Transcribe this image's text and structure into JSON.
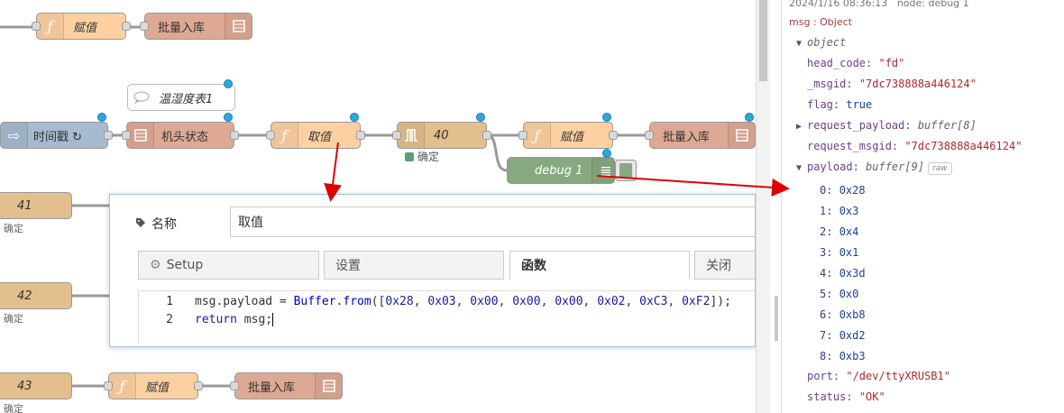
{
  "canvas": {
    "nodes": {
      "func_top": "赋值",
      "db_top": "批量入库",
      "comment": "温湿度表1",
      "inject": "时间戳 ↻",
      "serial_head": "机头状态",
      "func_take": "取值",
      "delay": "40",
      "func_assign": "赋值",
      "db_mid": "批量入库",
      "debug": "debug 1",
      "row41_label": "41",
      "row42_label": "42",
      "row43_label": "43",
      "func_bottom": "赋值",
      "db_bottom": "批量入库"
    },
    "status_ok": "确定",
    "left_status_1": "确定",
    "left_status_2": "确定",
    "left_status_3": "确定"
  },
  "dialog": {
    "name_label": "名称",
    "name_value": "取值",
    "tabs": [
      {
        "label": "Setup"
      },
      {
        "label": "设置"
      },
      {
        "label": "函数"
      },
      {
        "label": "关闭"
      }
    ],
    "code": {
      "line_numbers": [
        "1",
        "2"
      ],
      "line1": {
        "prefix": "msg.payload = ",
        "obj": "Buffer",
        "dot": ".",
        "method": "from",
        "args_open": "([",
        "nums": [
          "0x28",
          "0x03",
          "0x00",
          "0x00",
          "0x00",
          "0x02",
          "0xC3",
          "0xF2"
        ],
        "args_close": "]);"
      },
      "line2": {
        "kw": "return",
        "rest": " msg;"
      }
    }
  },
  "debug": {
    "timestamp": "2024/1/16 08:36:13",
    "node": "node: debug 1",
    "topic": "msg : Object",
    "object_label": "object",
    "fields": {
      "head_code_key": "head_code:",
      "head_code_val": "\"fd\"",
      "msgid_key": "_msgid:",
      "msgid_val": "\"7dc738888a446124\"",
      "flag_key": "flag:",
      "flag_val": "true",
      "request_payload_key": "request_payload:",
      "request_payload_type": "buffer[8]",
      "request_msgid_key": "request_msgid:",
      "request_msgid_val": "\"7dc738888a446124\"",
      "payload_key": "payload:",
      "payload_type": "buffer[9]",
      "raw": "raw",
      "port_key": "port:",
      "port_val": "\"/dev/ttyXRUSB1\"",
      "status_key": "status:",
      "status_val": "\"OK\""
    },
    "payload_items": [
      {
        "idx": "0:",
        "val": "0x28"
      },
      {
        "idx": "1:",
        "val": "0x3"
      },
      {
        "idx": "2:",
        "val": "0x4"
      },
      {
        "idx": "3:",
        "val": "0x1"
      },
      {
        "idx": "4:",
        "val": "0x3d"
      },
      {
        "idx": "5:",
        "val": "0x0"
      },
      {
        "idx": "6:",
        "val": "0xb8"
      },
      {
        "idx": "7:",
        "val": "0xd2"
      },
      {
        "idx": "8:",
        "val": "0xb3"
      }
    ]
  },
  "colors": {
    "function": "#fdd0a2",
    "database": "#dea994",
    "inject": "#a6bbcf",
    "delay": "#e2bf8c",
    "debug": "#87a980",
    "annotation_arrow": "#e00000",
    "changed_dot": "#2ea7e0"
  },
  "icons": {
    "function": "function-icon",
    "database": "database-icon",
    "inject": "inject-arrow-icon",
    "delay": "delay-pulse-icon",
    "debug": "list-icon",
    "comment": "speech-bubble-icon",
    "name": "tag-icon",
    "setup": "gear-icon"
  }
}
